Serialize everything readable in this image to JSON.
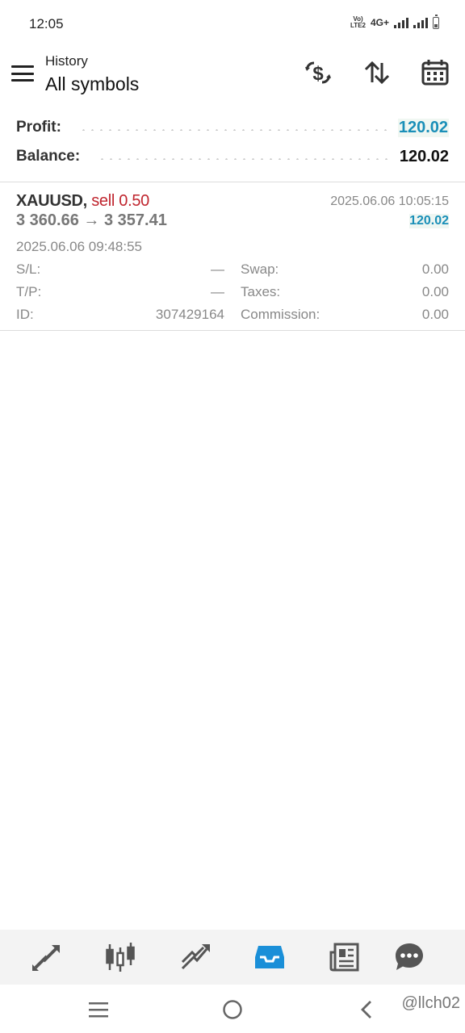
{
  "status_bar": {
    "time": "12:05",
    "volte_label": "Vo)) LTE2",
    "network": "4G+"
  },
  "toolbar": {
    "subtitle": "History",
    "title": "All symbols",
    "icons": [
      "menu-icon",
      "currency-exchange-icon",
      "sort-icon",
      "calendar-icon"
    ]
  },
  "summary": {
    "profit_label": "Profit:",
    "profit_value": "120.02",
    "balance_label": "Balance:",
    "balance_value": "120.02"
  },
  "trade": {
    "symbol": "XAUUSD,",
    "side": "sell 0.50",
    "close_time": "2025.06.06 10:05:15",
    "prices": "3 360.66 → 3 357.41",
    "profit": "120.02",
    "open_time": "2025.06.06 09:48:55",
    "details": {
      "sl_label": "S/L:",
      "sl_value": "—",
      "tp_label": "T/P:",
      "tp_value": "—",
      "id_label": "ID:",
      "id_value": "307429164",
      "swap_label": "Swap:",
      "swap_value": "0.00",
      "taxes_label": "Taxes:",
      "taxes_value": "0.00",
      "commission_label": "Commission:",
      "commission_value": "0.00"
    }
  },
  "bottom_nav": {
    "items": [
      "quotes-icon",
      "chart-icon",
      "trade-icon",
      "history-icon",
      "news-icon",
      "messages-icon"
    ],
    "active": "history-icon",
    "active_color": "#1a8fd8"
  },
  "system_nav": {
    "watermark": "@llch02"
  },
  "colors": {
    "accent": "#1a8fb8",
    "sell": "#c0262f"
  }
}
